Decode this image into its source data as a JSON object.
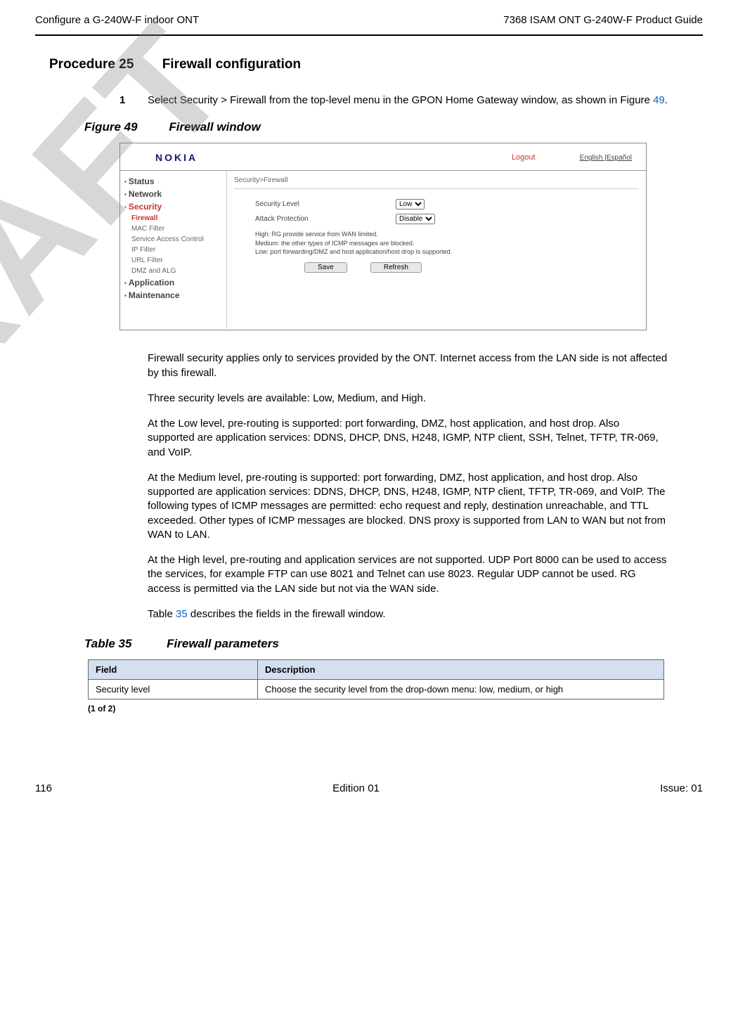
{
  "header": {
    "left": "Configure a G-240W-F indoor ONT",
    "right": "7368 ISAM ONT G-240W-F Product Guide"
  },
  "watermark": "DRAFT",
  "procedure": {
    "label": "Procedure 25",
    "title": "Firewall configuration"
  },
  "step1": {
    "num": "1",
    "text_a": "Select Security > Firewall from the top-level menu in the GPON Home Gateway window, as shown in Figure ",
    "fig_ref": "49",
    "text_b": "."
  },
  "figure": {
    "label": "Figure 49",
    "title": "Firewall window"
  },
  "screenshot": {
    "logo": "NOKIA",
    "logout": "Logout",
    "lang_a": "English",
    "lang_sep": " |",
    "lang_b": "Español",
    "crumb": "Security>Firewall",
    "sidebar": {
      "status": "Status",
      "network": "Network",
      "security": "Security",
      "firewall": "Firewall",
      "macfilter": "MAC Filter",
      "sac": "Service Access Control",
      "ipfilter": "IP Filter",
      "urlfilter": "URL Filter",
      "dmzalg": "DMZ and ALG",
      "application": "Application",
      "maintenance": "Maintenance"
    },
    "row1": {
      "label": "Security Level",
      "value": "Low"
    },
    "row2": {
      "label": "Attack Protection",
      "value": "Disable"
    },
    "hint1": "High: RG provide service from WAN limited.",
    "hint2": "Medium: the other types of ICMP messages are blocked.",
    "hint3": "Low: port forwarding/DMZ and host application/host drop is supported.",
    "save": "Save",
    "refresh": "Refresh"
  },
  "paras": {
    "p1": "Firewall security applies only to services provided by the ONT. Internet access from the LAN side is not affected by this firewall.",
    "p2": "Three security levels are available: Low, Medium, and High.",
    "p3": "At the Low level, pre-routing is supported: port forwarding, DMZ, host application, and host drop. Also supported are application services: DDNS, DHCP, DNS, H248, IGMP, NTP client, SSH, Telnet, TFTP, TR-069, and VoIP.",
    "p4": "At the Medium level, pre-routing is supported: port forwarding, DMZ, host application, and host drop. Also supported are application services: DDNS, DHCP, DNS, H248, IGMP, NTP client, TFTP, TR-069, and VoIP. The following types of ICMP messages are permitted: echo request and reply, destination unreachable, and TTL exceeded. Other types of ICMP messages are blocked. DNS proxy is supported from LAN to WAN but not from WAN to LAN.",
    "p5": "At the High level, pre-routing and application services are not supported. UDP Port 8000 can be used to access the services, for example FTP can use 8021 and Telnet can use 8023. Regular UDP cannot be used. RG access is permitted via the LAN side but not via the WAN side.",
    "p6_a": "Table ",
    "p6_link": "35",
    "p6_b": " describes the fields in the firewall window."
  },
  "table": {
    "label": "Table 35",
    "title": "Firewall parameters",
    "h1": "Field",
    "h2": "Description",
    "r1c1": "Security level",
    "r1c2": "Choose the security level from the drop-down menu: low, medium, or high",
    "foot": "(1 of 2)"
  },
  "footer": {
    "left": "116",
    "center": "Edition 01",
    "right": "Issue: 01"
  }
}
